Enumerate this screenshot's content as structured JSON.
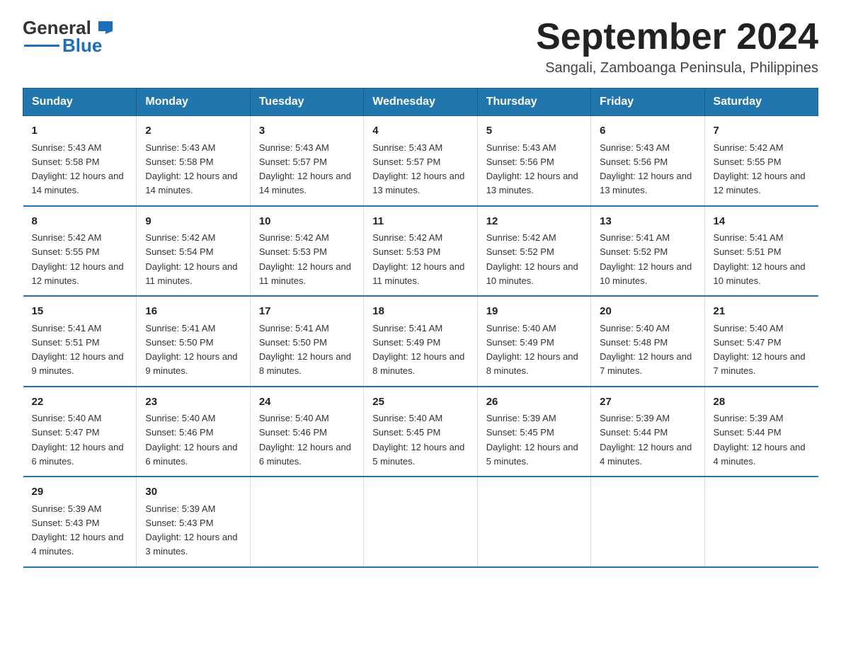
{
  "header": {
    "logo_general": "General",
    "logo_blue": "Blue",
    "title": "September 2024",
    "subtitle": "Sangali, Zamboanga Peninsula, Philippines"
  },
  "days_of_week": [
    "Sunday",
    "Monday",
    "Tuesday",
    "Wednesday",
    "Thursday",
    "Friday",
    "Saturday"
  ],
  "weeks": [
    [
      {
        "day": "1",
        "sunrise": "Sunrise: 5:43 AM",
        "sunset": "Sunset: 5:58 PM",
        "daylight": "Daylight: 12 hours and 14 minutes."
      },
      {
        "day": "2",
        "sunrise": "Sunrise: 5:43 AM",
        "sunset": "Sunset: 5:58 PM",
        "daylight": "Daylight: 12 hours and 14 minutes."
      },
      {
        "day": "3",
        "sunrise": "Sunrise: 5:43 AM",
        "sunset": "Sunset: 5:57 PM",
        "daylight": "Daylight: 12 hours and 14 minutes."
      },
      {
        "day": "4",
        "sunrise": "Sunrise: 5:43 AM",
        "sunset": "Sunset: 5:57 PM",
        "daylight": "Daylight: 12 hours and 13 minutes."
      },
      {
        "day": "5",
        "sunrise": "Sunrise: 5:43 AM",
        "sunset": "Sunset: 5:56 PM",
        "daylight": "Daylight: 12 hours and 13 minutes."
      },
      {
        "day": "6",
        "sunrise": "Sunrise: 5:43 AM",
        "sunset": "Sunset: 5:56 PM",
        "daylight": "Daylight: 12 hours and 13 minutes."
      },
      {
        "day": "7",
        "sunrise": "Sunrise: 5:42 AM",
        "sunset": "Sunset: 5:55 PM",
        "daylight": "Daylight: 12 hours and 12 minutes."
      }
    ],
    [
      {
        "day": "8",
        "sunrise": "Sunrise: 5:42 AM",
        "sunset": "Sunset: 5:55 PM",
        "daylight": "Daylight: 12 hours and 12 minutes."
      },
      {
        "day": "9",
        "sunrise": "Sunrise: 5:42 AM",
        "sunset": "Sunset: 5:54 PM",
        "daylight": "Daylight: 12 hours and 11 minutes."
      },
      {
        "day": "10",
        "sunrise": "Sunrise: 5:42 AM",
        "sunset": "Sunset: 5:53 PM",
        "daylight": "Daylight: 12 hours and 11 minutes."
      },
      {
        "day": "11",
        "sunrise": "Sunrise: 5:42 AM",
        "sunset": "Sunset: 5:53 PM",
        "daylight": "Daylight: 12 hours and 11 minutes."
      },
      {
        "day": "12",
        "sunrise": "Sunrise: 5:42 AM",
        "sunset": "Sunset: 5:52 PM",
        "daylight": "Daylight: 12 hours and 10 minutes."
      },
      {
        "day": "13",
        "sunrise": "Sunrise: 5:41 AM",
        "sunset": "Sunset: 5:52 PM",
        "daylight": "Daylight: 12 hours and 10 minutes."
      },
      {
        "day": "14",
        "sunrise": "Sunrise: 5:41 AM",
        "sunset": "Sunset: 5:51 PM",
        "daylight": "Daylight: 12 hours and 10 minutes."
      }
    ],
    [
      {
        "day": "15",
        "sunrise": "Sunrise: 5:41 AM",
        "sunset": "Sunset: 5:51 PM",
        "daylight": "Daylight: 12 hours and 9 minutes."
      },
      {
        "day": "16",
        "sunrise": "Sunrise: 5:41 AM",
        "sunset": "Sunset: 5:50 PM",
        "daylight": "Daylight: 12 hours and 9 minutes."
      },
      {
        "day": "17",
        "sunrise": "Sunrise: 5:41 AM",
        "sunset": "Sunset: 5:50 PM",
        "daylight": "Daylight: 12 hours and 8 minutes."
      },
      {
        "day": "18",
        "sunrise": "Sunrise: 5:41 AM",
        "sunset": "Sunset: 5:49 PM",
        "daylight": "Daylight: 12 hours and 8 minutes."
      },
      {
        "day": "19",
        "sunrise": "Sunrise: 5:40 AM",
        "sunset": "Sunset: 5:49 PM",
        "daylight": "Daylight: 12 hours and 8 minutes."
      },
      {
        "day": "20",
        "sunrise": "Sunrise: 5:40 AM",
        "sunset": "Sunset: 5:48 PM",
        "daylight": "Daylight: 12 hours and 7 minutes."
      },
      {
        "day": "21",
        "sunrise": "Sunrise: 5:40 AM",
        "sunset": "Sunset: 5:47 PM",
        "daylight": "Daylight: 12 hours and 7 minutes."
      }
    ],
    [
      {
        "day": "22",
        "sunrise": "Sunrise: 5:40 AM",
        "sunset": "Sunset: 5:47 PM",
        "daylight": "Daylight: 12 hours and 6 minutes."
      },
      {
        "day": "23",
        "sunrise": "Sunrise: 5:40 AM",
        "sunset": "Sunset: 5:46 PM",
        "daylight": "Daylight: 12 hours and 6 minutes."
      },
      {
        "day": "24",
        "sunrise": "Sunrise: 5:40 AM",
        "sunset": "Sunset: 5:46 PM",
        "daylight": "Daylight: 12 hours and 6 minutes."
      },
      {
        "day": "25",
        "sunrise": "Sunrise: 5:40 AM",
        "sunset": "Sunset: 5:45 PM",
        "daylight": "Daylight: 12 hours and 5 minutes."
      },
      {
        "day": "26",
        "sunrise": "Sunrise: 5:39 AM",
        "sunset": "Sunset: 5:45 PM",
        "daylight": "Daylight: 12 hours and 5 minutes."
      },
      {
        "day": "27",
        "sunrise": "Sunrise: 5:39 AM",
        "sunset": "Sunset: 5:44 PM",
        "daylight": "Daylight: 12 hours and 4 minutes."
      },
      {
        "day": "28",
        "sunrise": "Sunrise: 5:39 AM",
        "sunset": "Sunset: 5:44 PM",
        "daylight": "Daylight: 12 hours and 4 minutes."
      }
    ],
    [
      {
        "day": "29",
        "sunrise": "Sunrise: 5:39 AM",
        "sunset": "Sunset: 5:43 PM",
        "daylight": "Daylight: 12 hours and 4 minutes."
      },
      {
        "day": "30",
        "sunrise": "Sunrise: 5:39 AM",
        "sunset": "Sunset: 5:43 PM",
        "daylight": "Daylight: 12 hours and 3 minutes."
      },
      null,
      null,
      null,
      null,
      null
    ]
  ]
}
